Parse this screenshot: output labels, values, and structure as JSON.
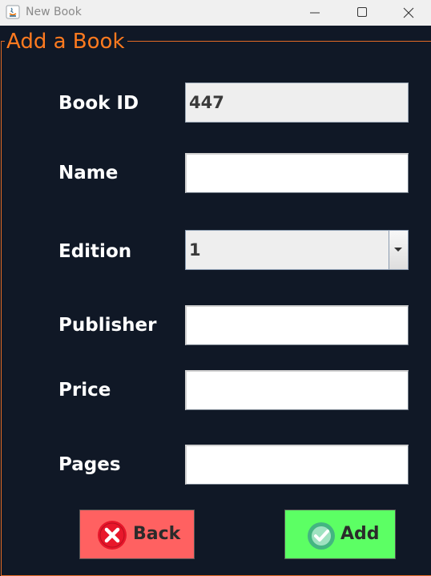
{
  "window": {
    "title": "New Book",
    "icon": "java-icon",
    "controls": [
      "minimize-icon",
      "maximize-icon",
      "close-icon"
    ]
  },
  "form": {
    "group_title": "Add a Book",
    "accent_color": "#ff7a1f",
    "background_color": "#101826",
    "fields": {
      "book_id": {
        "label": "Book ID",
        "value": "447",
        "editable": false
      },
      "name": {
        "label": "Name",
        "value": ""
      },
      "edition": {
        "label": "Edition",
        "selected": "1"
      },
      "publisher": {
        "label": "Publisher",
        "value": ""
      },
      "price": {
        "label": "Price",
        "value": ""
      },
      "pages": {
        "label": "Pages",
        "value": ""
      }
    }
  },
  "buttons": {
    "back": {
      "label": "Back",
      "icon": "x-circle-icon",
      "color": "#ff6161"
    },
    "add": {
      "label": "Add",
      "icon": "check-circle-icon",
      "color": "#5cff64"
    }
  }
}
